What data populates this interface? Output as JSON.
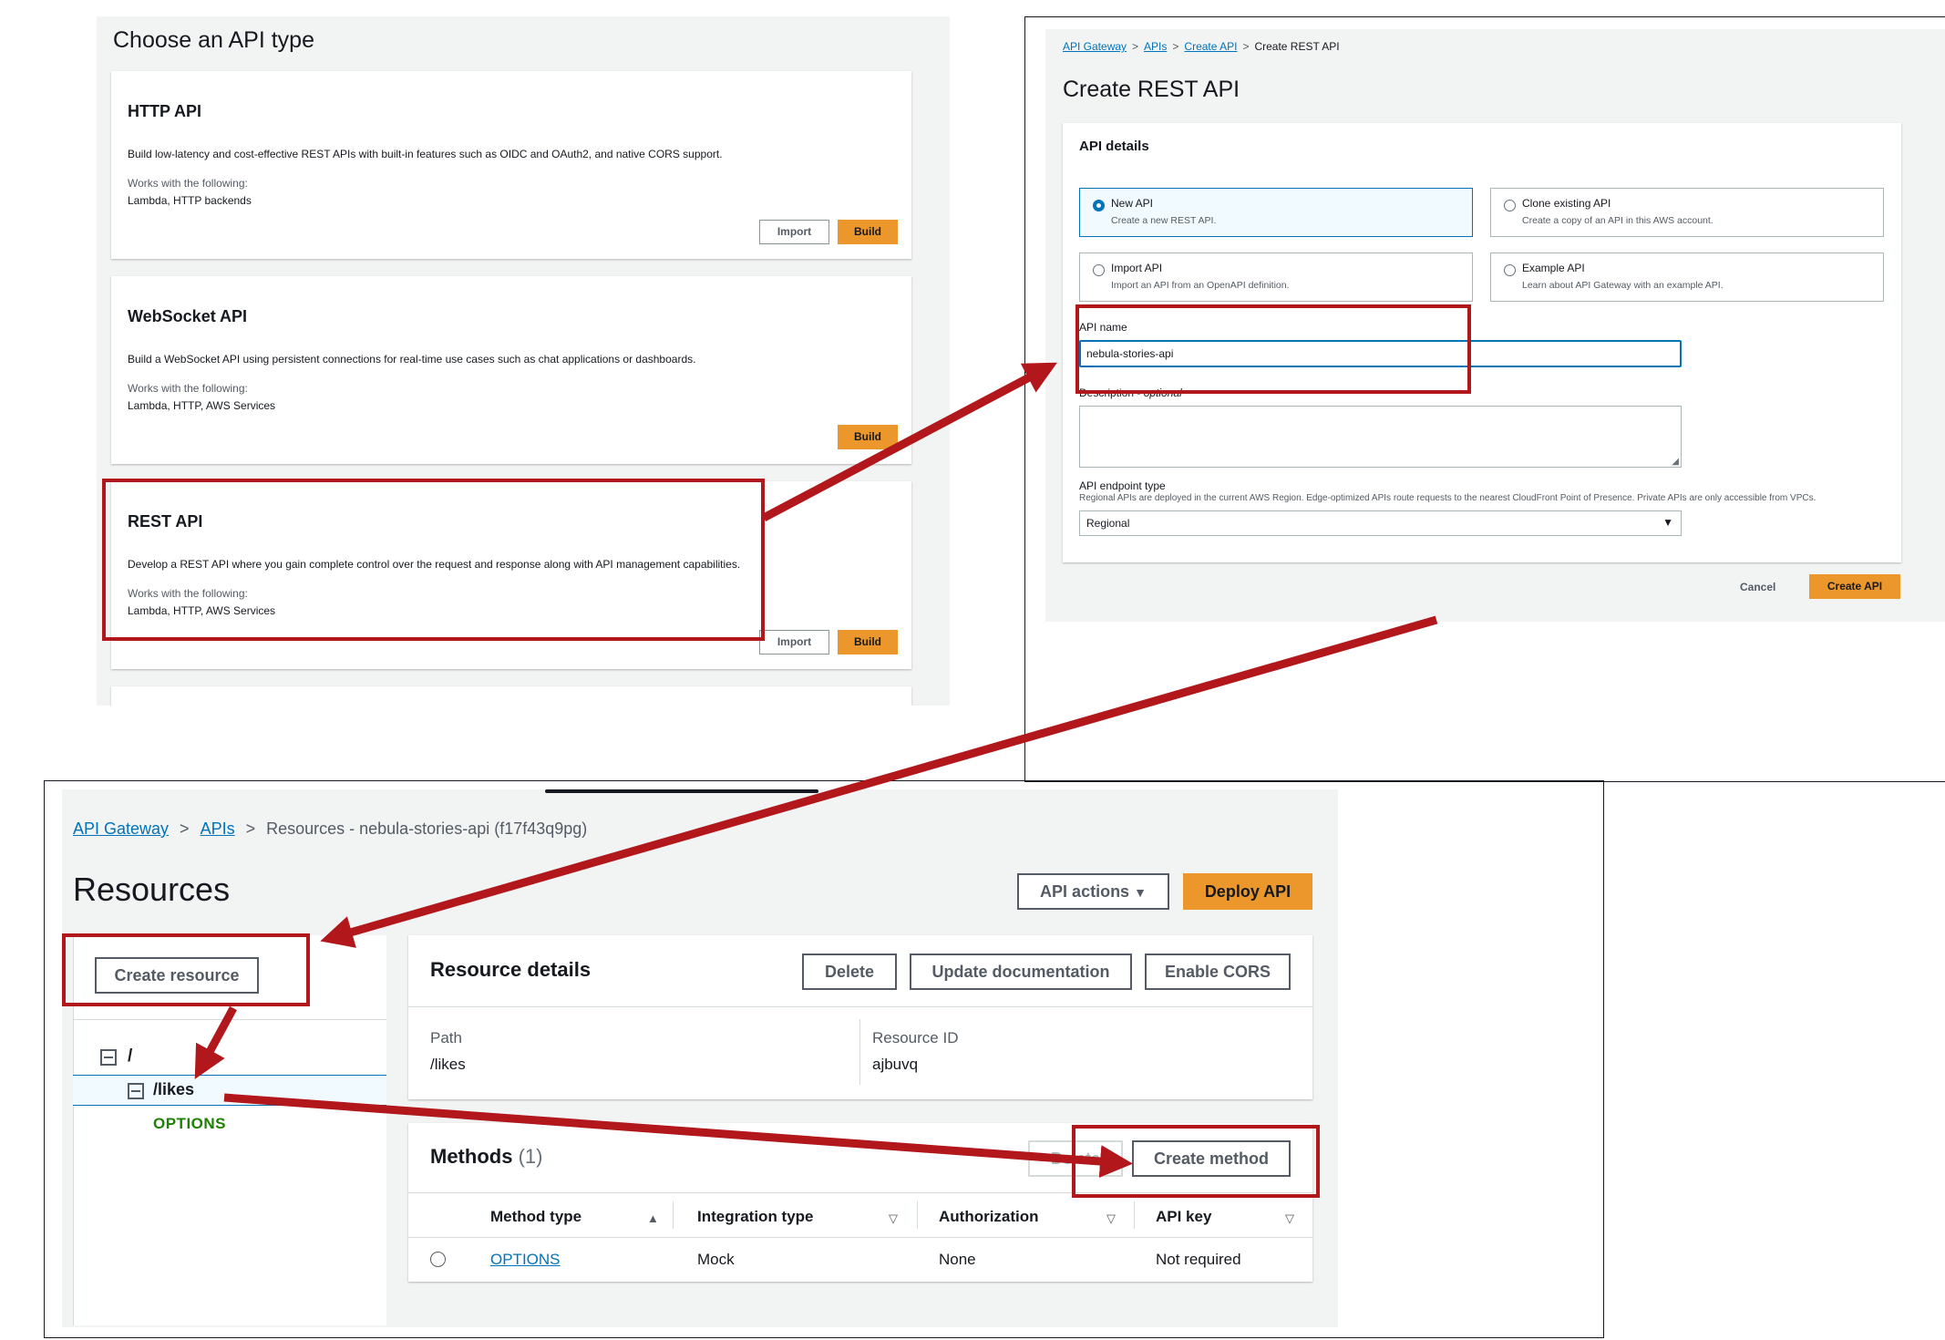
{
  "panel_api_type": {
    "heading": "Choose an API type",
    "cards": [
      {
        "title": "HTTP API",
        "description": "Build low-latency and cost-effective REST APIs with built-in features such as OIDC and OAuth2, and native CORS support.",
        "works_with_label": "Works with the following:",
        "works_with": "Lambda, HTTP backends",
        "import_label": "Import",
        "build_label": "Build"
      },
      {
        "title": "WebSocket API",
        "description": "Build a WebSocket API using persistent connections for real-time use cases such as chat applications or dashboards.",
        "works_with_label": "Works with the following:",
        "works_with": "Lambda, HTTP, AWS Services",
        "build_label": "Build"
      },
      {
        "title": "REST API",
        "description": "Develop a REST API where you gain complete control over the request and response along with API management capabilities.",
        "works_with_label": "Works with the following:",
        "works_with": "Lambda, HTTP, AWS Services",
        "import_label": "Import",
        "build_label": "Build"
      }
    ]
  },
  "panel_create": {
    "breadcrumb": [
      "API Gateway",
      "APIs",
      "Create API",
      "Create REST API"
    ],
    "title": "Create REST API",
    "section_title": "API details",
    "options": [
      {
        "title": "New API",
        "subtitle": "Create a new REST API.",
        "selected": true
      },
      {
        "title": "Clone existing API",
        "subtitle": "Create a copy of an API in this AWS account.",
        "selected": false
      },
      {
        "title": "Import API",
        "subtitle": "Import an API from an OpenAPI definition.",
        "selected": false
      },
      {
        "title": "Example API",
        "subtitle": "Learn about API Gateway with an example API.",
        "selected": false
      }
    ],
    "api_name_label": "API name",
    "api_name_value": "nebula-stories-api",
    "description_label": "Description - ",
    "description_optional": "optional",
    "endpoint_label": "API endpoint type",
    "endpoint_help": "Regional APIs are deployed in the current AWS Region. Edge-optimized APIs route requests to the nearest CloudFront Point of Presence. Private APIs are only accessible from VPCs.",
    "endpoint_value": "Regional",
    "cancel_label": "Cancel",
    "create_label": "Create API"
  },
  "panel_resources": {
    "breadcrumb": [
      "API Gateway",
      "APIs",
      "Resources - nebula-stories-api (f17f43q9pg)"
    ],
    "title": "Resources",
    "api_actions_label": "API actions",
    "deploy_label": "Deploy API",
    "create_resource_label": "Create resource",
    "tree": {
      "root": "/",
      "child": "/likes",
      "method": "OPTIONS"
    },
    "details_title": "Resource details",
    "delete_label": "Delete",
    "update_doc_label": "Update documentation",
    "enable_cors_label": "Enable CORS",
    "path_label": "Path",
    "path_value": "/likes",
    "resource_id_label": "Resource ID",
    "resource_id_value": "ajbuvq",
    "methods_title": "Methods",
    "methods_count": "(1)",
    "methods_delete_label": "Delete",
    "create_method_label": "Create method",
    "columns": [
      "Method type",
      "Integration type",
      "Authorization",
      "API key"
    ],
    "row": {
      "method": "OPTIONS",
      "integration": "Mock",
      "authorization": "None",
      "api_key": "Not required"
    }
  },
  "colors": {
    "accent_orange": "#ec972c",
    "link_blue": "#0073bb",
    "annotation_red": "#b1171b",
    "panel_bg": "#f2f3f3"
  }
}
